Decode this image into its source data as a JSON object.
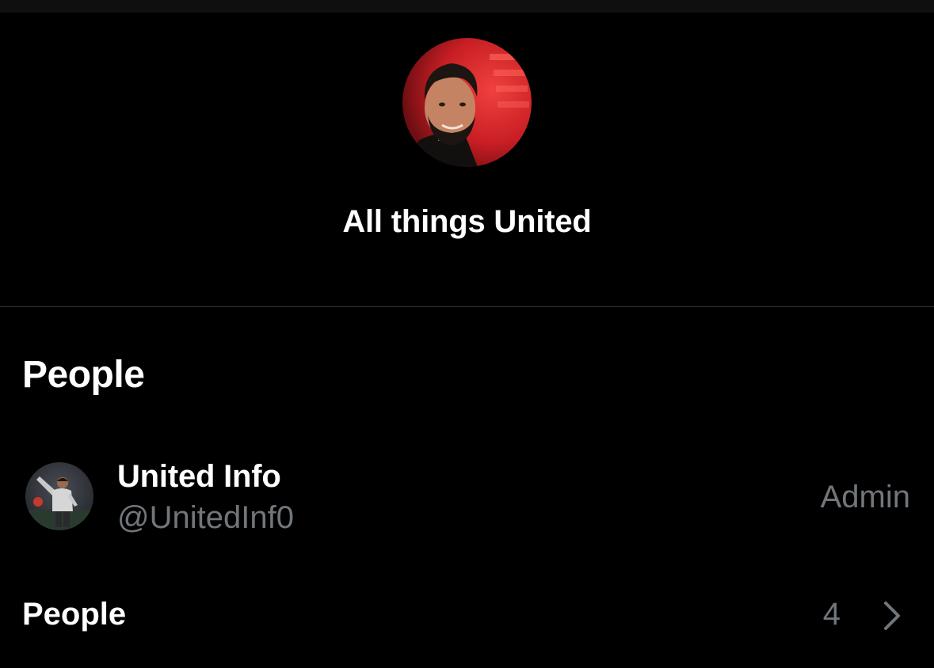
{
  "group": {
    "title": "All things United"
  },
  "section": {
    "heading": "People"
  },
  "members": [
    {
      "name": "United Info",
      "handle": "@UnitedInf0",
      "role": "Admin"
    }
  ],
  "people_row": {
    "label": "People",
    "count": "4"
  },
  "icons": {
    "group_avatar": "group-avatar-image",
    "member_avatar": "member-avatar-image",
    "chevron": "chevron-right-icon"
  },
  "colors": {
    "background": "#000000",
    "primary_text": "#ffffff",
    "secondary_text": "#71767b",
    "divider": "#2f3336"
  }
}
